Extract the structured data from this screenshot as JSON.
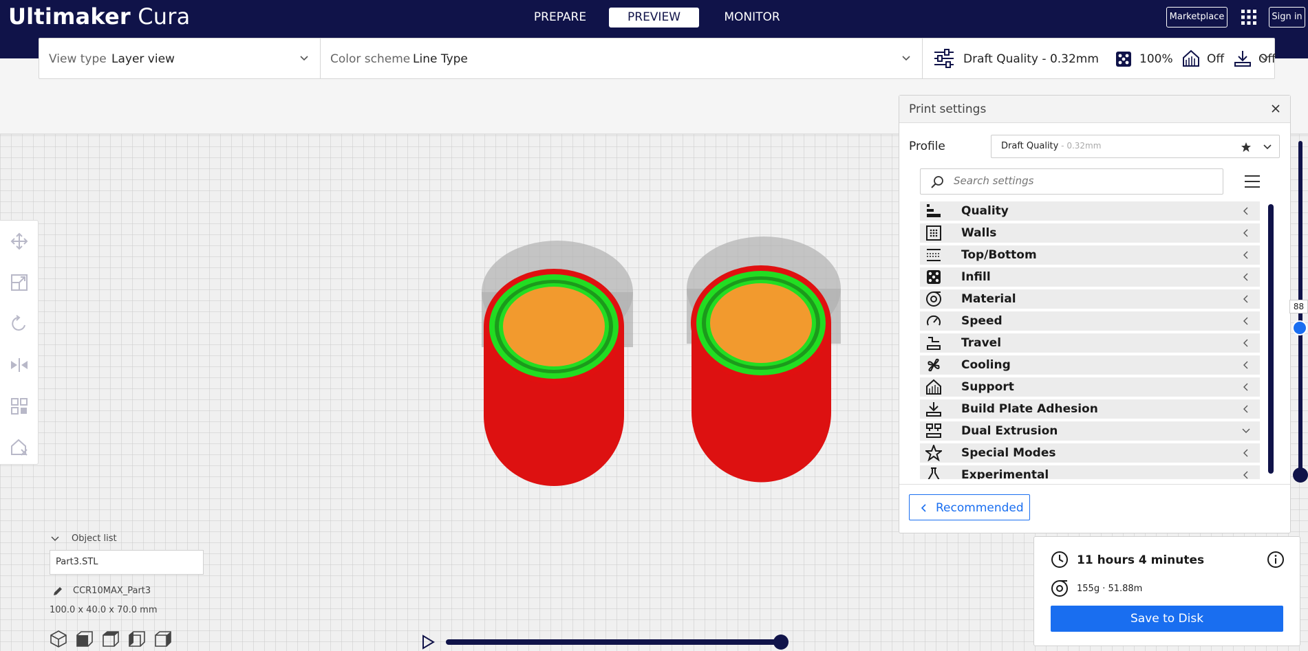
{
  "app": {
    "brand_bold": "Ultimaker",
    "brand_light": "Cura"
  },
  "stages": [
    {
      "label": "PREPARE",
      "active": false
    },
    {
      "label": "PREVIEW",
      "active": true
    },
    {
      "label": "MONITOR",
      "active": false
    }
  ],
  "header": {
    "marketplace_label": "Marketplace",
    "signin_label": "Sign in"
  },
  "toolbar": {
    "view_type_label": "View type",
    "view_type_value": "Layer view",
    "color_scheme_label": "Color scheme",
    "color_scheme_value": "Line Type",
    "quality_value": "Draft Quality - 0.32mm",
    "infill_value": "100%",
    "support_value": "Off",
    "adhesion_value": "Off"
  },
  "print_settings": {
    "title": "Print settings",
    "profile_label": "Profile",
    "profile_value": "Draft Quality",
    "profile_sub": " - 0.32mm",
    "search_placeholder": "Search settings",
    "categories": [
      {
        "label": "Quality",
        "icon": "quality-icon",
        "expanded": false
      },
      {
        "label": "Walls",
        "icon": "walls-icon",
        "expanded": false
      },
      {
        "label": "Top/Bottom",
        "icon": "top-bottom-icon",
        "expanded": false
      },
      {
        "label": "Infill",
        "icon": "infill-icon",
        "expanded": false
      },
      {
        "label": "Material",
        "icon": "material-icon",
        "expanded": false
      },
      {
        "label": "Speed",
        "icon": "speed-icon",
        "expanded": false
      },
      {
        "label": "Travel",
        "icon": "travel-icon",
        "expanded": false
      },
      {
        "label": "Cooling",
        "icon": "cooling-icon",
        "expanded": false
      },
      {
        "label": "Support",
        "icon": "support-icon",
        "expanded": false
      },
      {
        "label": "Build Plate Adhesion",
        "icon": "adhesion-icon",
        "expanded": false
      },
      {
        "label": "Dual Extrusion",
        "icon": "dual-extrusion-icon",
        "expanded": true
      },
      {
        "label": "Special Modes",
        "icon": "special-modes-icon",
        "expanded": false
      },
      {
        "label": "Experimental",
        "icon": "experimental-icon",
        "expanded": false
      }
    ],
    "recommended_label": "Recommended"
  },
  "estimate": {
    "time": "11 hours 4 minutes",
    "material": "155g · 51.88m",
    "save_label": "Save to Disk"
  },
  "object_list": {
    "title": "Object list",
    "item": "Part3.STL",
    "job_name": "CCR10MAX_Part3",
    "dimensions": "100.0 x 40.0 x 70.0 mm"
  },
  "layer_slider": {
    "current_layer": "88"
  },
  "colors": {
    "header_bg": "#101349",
    "accent": "#196ef0",
    "model_wall": "#e01010",
    "inner_wall": "#22dd22",
    "infill": "#f29a2e"
  }
}
